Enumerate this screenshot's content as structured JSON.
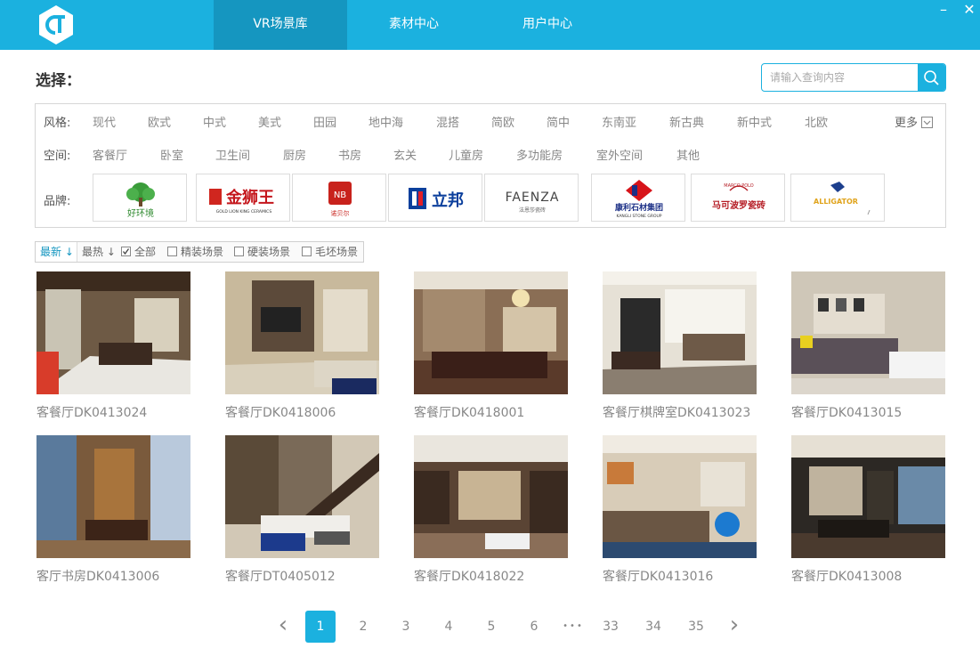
{
  "nav": {
    "tabs": [
      {
        "label": "VR场景库",
        "active": true
      },
      {
        "label": "素材中心",
        "active": false
      },
      {
        "label": "用户中心",
        "active": false
      }
    ],
    "minimize_label": "–",
    "close_label": "✕"
  },
  "select_title": "选择：",
  "search": {
    "placeholder": "请输入查询内容",
    "value": ""
  },
  "filters": {
    "style": {
      "label": "风格:",
      "options": [
        "现代",
        "欧式",
        "中式",
        "美式",
        "田园",
        "地中海",
        "混搭",
        "简欧",
        "简中",
        "东南亚",
        "新古典",
        "新中式",
        "北欧"
      ],
      "more_label": "更多"
    },
    "space": {
      "label": "空间:",
      "options": [
        "客餐厅",
        "卧室",
        "卫生间",
        "厨房",
        "书房",
        "玄关",
        "儿童房",
        "多功能房",
        "室外空间",
        "其他"
      ]
    },
    "brand": {
      "label": "品牌:",
      "items": [
        {
          "name": "好环境"
        },
        {
          "name": "金狮王",
          "sub": "GOLD LION KING CERAMICS"
        },
        {
          "name": "诺贝尔"
        },
        {
          "name": "立邦"
        },
        {
          "name": "FAENZA",
          "sub": "法恩莎瓷砖"
        },
        {
          "name": "康利石材集团",
          "sub": "KANGLI STONE GROUP"
        },
        {
          "name": "马可波罗瓷砖",
          "sub": "MARCO POLO"
        },
        {
          "name": "ALLIGATOR"
        }
      ]
    }
  },
  "sort": {
    "newest": "最新",
    "hottest": "最热",
    "checks": [
      {
        "label": "全部",
        "checked": true
      },
      {
        "label": "精装场景",
        "checked": false
      },
      {
        "label": "硬装场景",
        "checked": false
      },
      {
        "label": "毛坯场景",
        "checked": false
      }
    ]
  },
  "scenes": [
    {
      "title": "客餐厅DK0413024"
    },
    {
      "title": "客餐厅DK0418006"
    },
    {
      "title": "客餐厅DK0418001"
    },
    {
      "title": "客餐厅棋牌室DK0413023"
    },
    {
      "title": "客餐厅DK0413015"
    },
    {
      "title": "客厅书房DK0413006"
    },
    {
      "title": "客餐厅DT0405012"
    },
    {
      "title": "客餐厅DK0418022"
    },
    {
      "title": "客餐厅DK0413016"
    },
    {
      "title": "客餐厅DK0413008"
    }
  ],
  "pagination": {
    "prev": "‹",
    "next": "›",
    "pages": [
      "1",
      "2",
      "3",
      "4",
      "5",
      "6",
      "33",
      "34",
      "35"
    ],
    "ellipsis": "•••",
    "current": "1"
  },
  "colors": {
    "accent": "#1bb1df",
    "accent_dark": "#1596c0"
  }
}
